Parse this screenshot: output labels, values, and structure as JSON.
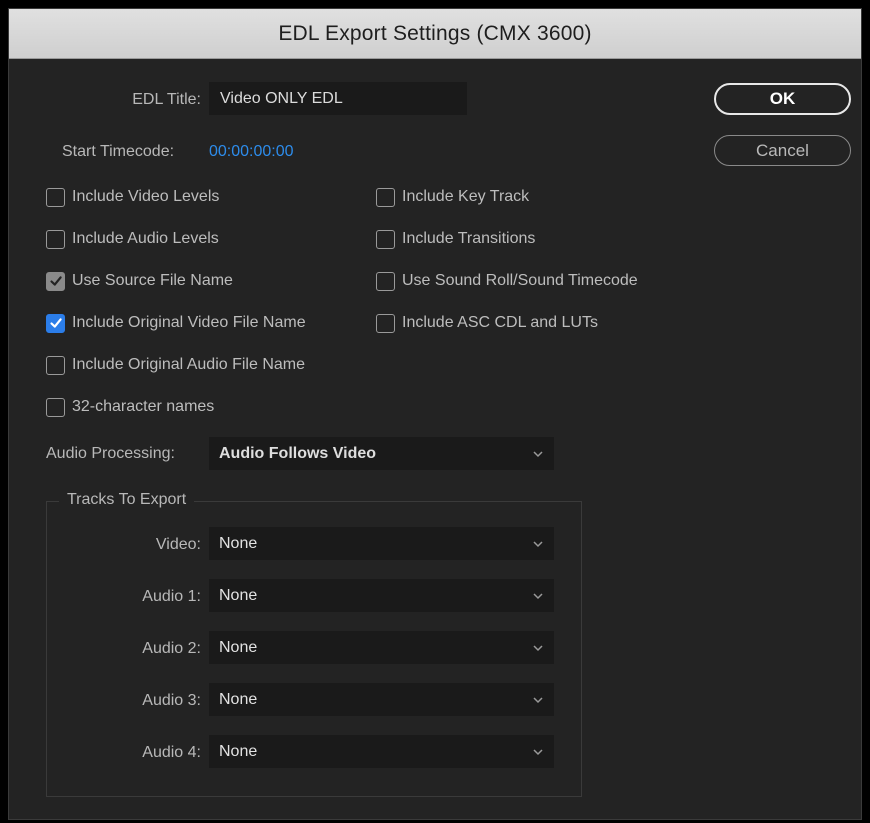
{
  "window": {
    "title": "EDL Export Settings (CMX 3600)"
  },
  "edl_title": {
    "label": "EDL Title:",
    "value": "Video ONLY EDL"
  },
  "start_timecode": {
    "label": "Start Timecode:",
    "value": "00:00:00:00"
  },
  "buttons": {
    "ok": "OK",
    "cancel": "Cancel"
  },
  "options": {
    "left": [
      {
        "label": "Include Video Levels",
        "checked": false
      },
      {
        "label": "Include Audio Levels",
        "checked": false
      },
      {
        "label": "Use Source File Name",
        "checked": true
      },
      {
        "label": "Include Original Video File Name",
        "checked": true
      },
      {
        "label": "Include Original Audio File Name",
        "checked": false
      },
      {
        "label": "32-character names",
        "checked": false
      }
    ],
    "right": [
      {
        "label": "Include Key Track",
        "checked": false
      },
      {
        "label": "Include Transitions",
        "checked": false
      },
      {
        "label": "Use Sound Roll/Sound Timecode",
        "checked": false
      },
      {
        "label": "Include ASC CDL and LUTs",
        "checked": false
      }
    ]
  },
  "audio_processing": {
    "label": "Audio Processing:",
    "value": "Audio Follows Video"
  },
  "tracks": {
    "legend": "Tracks To Export",
    "rows": [
      {
        "label": "Video:",
        "value": "None"
      },
      {
        "label": "Audio 1:",
        "value": "None"
      },
      {
        "label": "Audio 2:",
        "value": "None"
      },
      {
        "label": "Audio 3:",
        "value": "None"
      },
      {
        "label": "Audio 4:",
        "value": "None"
      }
    ]
  },
  "colors": {
    "accent": "#2b7de9",
    "timecode": "#2d8ceb",
    "background": "#232323"
  }
}
